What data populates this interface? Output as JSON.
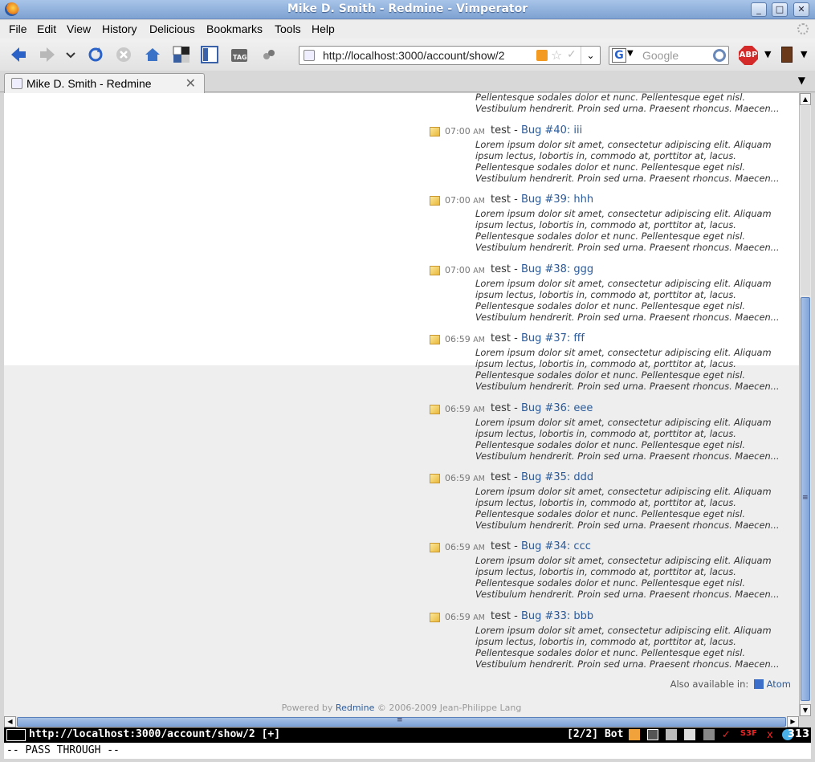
{
  "window": {
    "title": "Mike D. Smith - Redmine - Vimperator",
    "btn_min": "_",
    "btn_max": "□",
    "btn_close": "✕"
  },
  "menu": [
    "File",
    "Edit",
    "View",
    "History",
    "Delicious",
    "Bookmarks",
    "Tools",
    "Help"
  ],
  "toolbar": {
    "url": "http://localhost:3000/account/show/2",
    "url_dropdown": "⌄",
    "search_engine_letter": "G",
    "search_placeholder": "Google",
    "abp_label": "ABP",
    "tag_label": "TAG"
  },
  "tab": {
    "label": "Mike D. Smith - Redmine",
    "close": "✕"
  },
  "top_partial": {
    "lines": [
      "Pellentesque sodales dolor et nunc. Pellentesque eget nisl.",
      "Vestibulum hendrerit. Proin sed urna. Praesent rhoncus. Maecen..."
    ]
  },
  "entries": [
    {
      "time": "07:00",
      "ampm": "AM",
      "author": "test",
      "sep": " - ",
      "link": "Bug #40: iii"
    },
    {
      "time": "07:00",
      "ampm": "AM",
      "author": "test",
      "sep": " - ",
      "link": "Bug #39: hhh"
    },
    {
      "time": "07:00",
      "ampm": "AM",
      "author": "test",
      "sep": " - ",
      "link": "Bug #38: ggg"
    },
    {
      "time": "06:59",
      "ampm": "AM",
      "author": "test",
      "sep": " - ",
      "link": "Bug #37: fff"
    },
    {
      "time": "06:59",
      "ampm": "AM",
      "author": "test",
      "sep": " - ",
      "link": "Bug #36: eee"
    },
    {
      "time": "06:59",
      "ampm": "AM",
      "author": "test",
      "sep": " - ",
      "link": "Bug #35: ddd"
    },
    {
      "time": "06:59",
      "ampm": "AM",
      "author": "test",
      "sep": " - ",
      "link": "Bug #34: ccc"
    },
    {
      "time": "06:59",
      "ampm": "AM",
      "author": "test",
      "sep": " - ",
      "link": "Bug #33: bbb"
    }
  ],
  "lorem": [
    "Lorem ipsum dolor sit amet, consectetur adipiscing elit. Aliquam",
    "ipsum lectus, lobortis in, commodo at, porttitor at, lacus.",
    "Pellentesque sodales dolor et nunc. Pellentesque eget nisl.",
    "Vestibulum hendrerit. Proin sed urna. Praesent rhoncus. Maecen..."
  ],
  "atom": {
    "prefix": "Also available in:",
    "link": "Atom"
  },
  "footer": {
    "powered": "Powered by",
    "redmine": "Redmine",
    "copyright": "© 2006-2009 Jean-Philippe Lang"
  },
  "scroll_marks": {
    "up": "▲",
    "down": "▼",
    "left": "◀",
    "right": "▶",
    "grip": "≡"
  },
  "status": {
    "url": "http://localhost:3000/account/show/2 [+]",
    "position": "[2/2] Bot",
    "count": "313"
  },
  "cmdline": "-- PASS THROUGH --"
}
